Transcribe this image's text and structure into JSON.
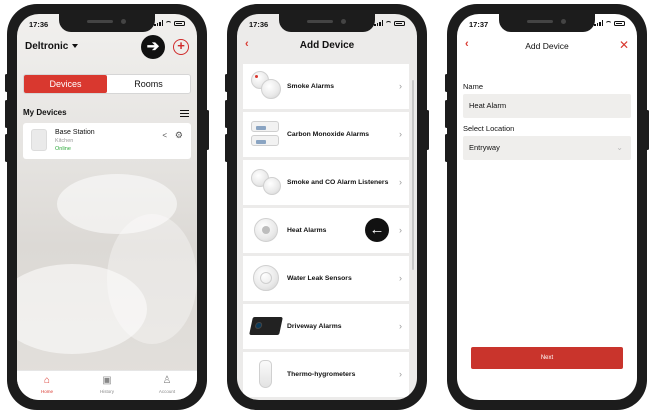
{
  "screen1": {
    "status_time": "17:36",
    "brand": "Deltronic",
    "segments": [
      {
        "label": "Devices",
        "active": true
      },
      {
        "label": "Rooms",
        "active": false
      }
    ],
    "section_title": "My Devices",
    "device": {
      "name": "Base Station",
      "room": "Kitchen",
      "status": "Online"
    },
    "tabs": [
      {
        "label": "Home",
        "icon": "home-icon",
        "active": true
      },
      {
        "label": "History",
        "icon": "history-icon",
        "active": false
      },
      {
        "label": "Account",
        "icon": "account-icon",
        "active": false
      }
    ],
    "arrow_glyph": "➔",
    "plus_glyph": "+"
  },
  "screen2": {
    "status_time": "17:36",
    "title": "Add Device",
    "back_glyph": "‹",
    "items": [
      {
        "label": "Smoke Alarms",
        "icon": "smoke-alarm-icon"
      },
      {
        "label": "Carbon Monoxide Alarms",
        "icon": "co-alarm-icon"
      },
      {
        "label": "Smoke and CO Alarm Listeners",
        "icon": "alarm-listener-icon"
      },
      {
        "label": "Heat Alarms",
        "icon": "heat-alarm-icon"
      },
      {
        "label": "Water Leak Sensors",
        "icon": "water-leak-icon"
      },
      {
        "label": "Driveway Alarms",
        "icon": "driveway-alarm-icon"
      },
      {
        "label": "Thermo-hygrometers",
        "icon": "thermo-hygrometer-icon"
      }
    ],
    "chevron": "›",
    "arrow_glyph": "←"
  },
  "screen3": {
    "status_time": "17:37",
    "title": "Add Device",
    "back_glyph": "‹",
    "close_glyph": "✕",
    "name_label": "Name",
    "name_value": "Heat Alarm",
    "location_label": "Select Location",
    "location_value": "Entryway",
    "next_label": "Next"
  },
  "colors": {
    "accent": "#d9382f",
    "online": "#2eaa3c",
    "background": "#ecebea"
  }
}
